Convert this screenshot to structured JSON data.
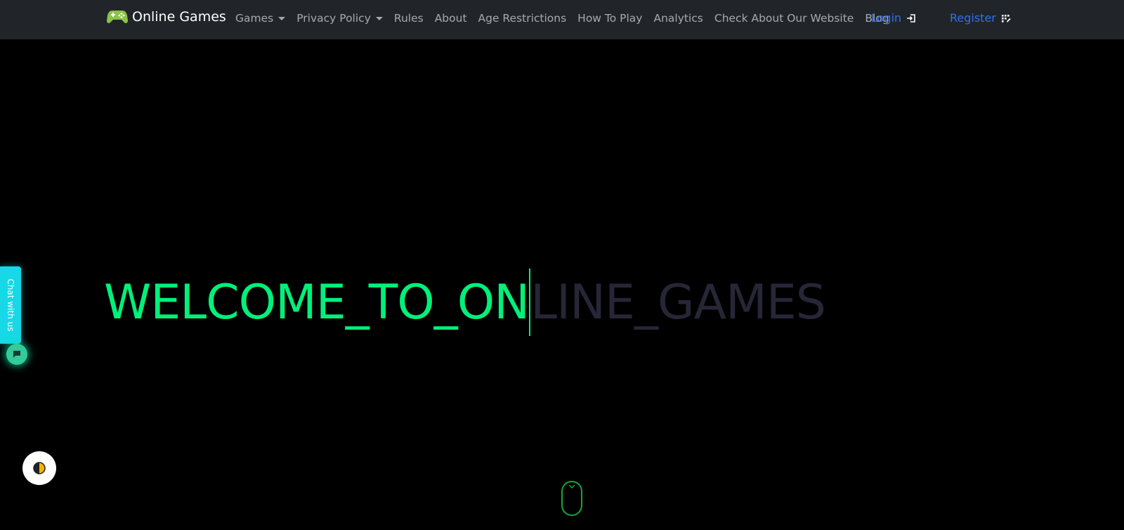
{
  "brand": {
    "name": "Online Games",
    "icon": "gamepad-icon",
    "icon_color": "#8bc34a"
  },
  "nav": {
    "items": [
      {
        "label": "Games",
        "dropdown": true
      },
      {
        "label": "Privacy Policy",
        "dropdown": true
      },
      {
        "label": "Rules",
        "dropdown": false
      },
      {
        "label": "About",
        "dropdown": false
      },
      {
        "label": "Age Restrictions",
        "dropdown": false
      },
      {
        "label": "How To Play",
        "dropdown": false
      },
      {
        "label": "Analytics",
        "dropdown": false
      },
      {
        "label": "Check About Our Website",
        "dropdown": false
      },
      {
        "label": "Blog",
        "dropdown": false
      }
    ],
    "login_label": "Login",
    "register_label": "Register"
  },
  "hero": {
    "typed_text": "WELCOME_TO_ON",
    "remaining_text": "LINE_GAMES",
    "typed_color": "#00f07a",
    "ghost_color": "#262637"
  },
  "chat": {
    "tab_label": "Chat with us",
    "icon": "chat-bubble-icon"
  },
  "theme_toggle": {
    "icon": "half-moon-icon"
  },
  "scroll_indicator": {
    "icon": "mouse-scroll-icon",
    "color": "#14a83a"
  },
  "colors": {
    "navbar_bg": "#212529",
    "page_bg": "#000000",
    "link_accent": "#2f6fef",
    "chat_accent": "#17d8e6"
  }
}
